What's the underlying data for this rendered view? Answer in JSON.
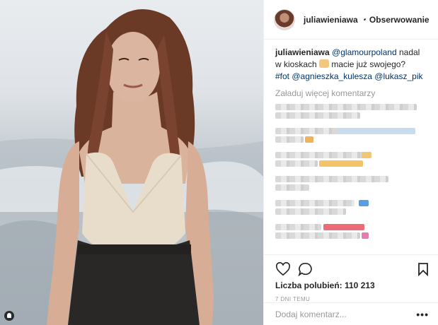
{
  "post": {
    "author": "juliawieniawa",
    "follow_label": "Obserwowanie",
    "dot": "•",
    "caption": {
      "username": "juliawieniawa",
      "mention_1": "@glamourpoland",
      "text_1": "nadal w kioskach",
      "text_2": "macie już swojego?",
      "hashtag": "#fot",
      "mention_2": "@agnieszka_kulesza",
      "mention_3": "@lukasz_pik"
    },
    "load_more": "Załaduj więcej komentarzy",
    "likes": "Liczba polubień: 110 213",
    "time": "7 DNI TEMU",
    "add_comment_placeholder": "Dodaj komentarz...",
    "more_symbol": "•••"
  },
  "icons": [
    "verified-badge-icon",
    "heart-icon",
    "comment-icon",
    "bookmark-icon",
    "tag-person-icon",
    "raised-hands-emoji"
  ],
  "colors": {
    "link": "#003569",
    "verified": "#3897f0",
    "muted": "#999999",
    "divider": "#efefef"
  }
}
